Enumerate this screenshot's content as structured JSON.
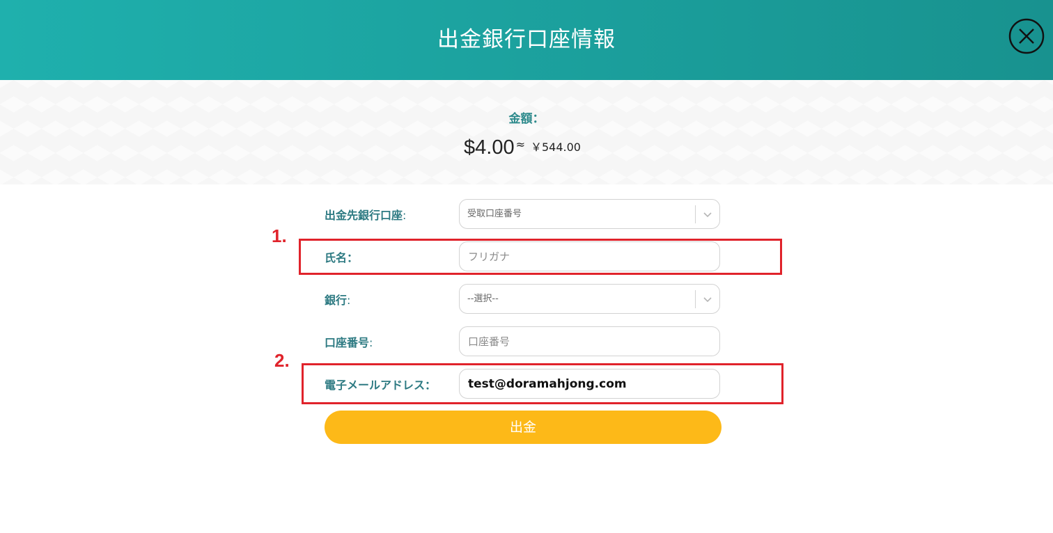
{
  "dialog": {
    "title": "出金銀行口座情報",
    "close_icon": "close-circle-icon"
  },
  "amount": {
    "label": "金額：",
    "usd": "$4.00",
    "approx": "≈",
    "jpy": "￥544.00"
  },
  "form": {
    "account": {
      "label": "出金先銀行口座",
      "colon": ":",
      "selected": "受取口座番号"
    },
    "name": {
      "label": "氏名：",
      "placeholder": "フリガナ"
    },
    "bank": {
      "label": "銀行",
      "colon": ":",
      "selected": "--選択--"
    },
    "account_number": {
      "label": "口座番号",
      "colon": ":",
      "placeholder": "口座番号"
    },
    "email": {
      "label": "電子メールアドレス：",
      "value": "test@doramahjong.com"
    },
    "submit_label": "出金"
  },
  "annotations": {
    "first": "1.",
    "second": "2.",
    "color": "#e0232b"
  },
  "colors": {
    "header": "#1fb0ad",
    "label": "#2d7a82",
    "button": "#fdb918"
  }
}
